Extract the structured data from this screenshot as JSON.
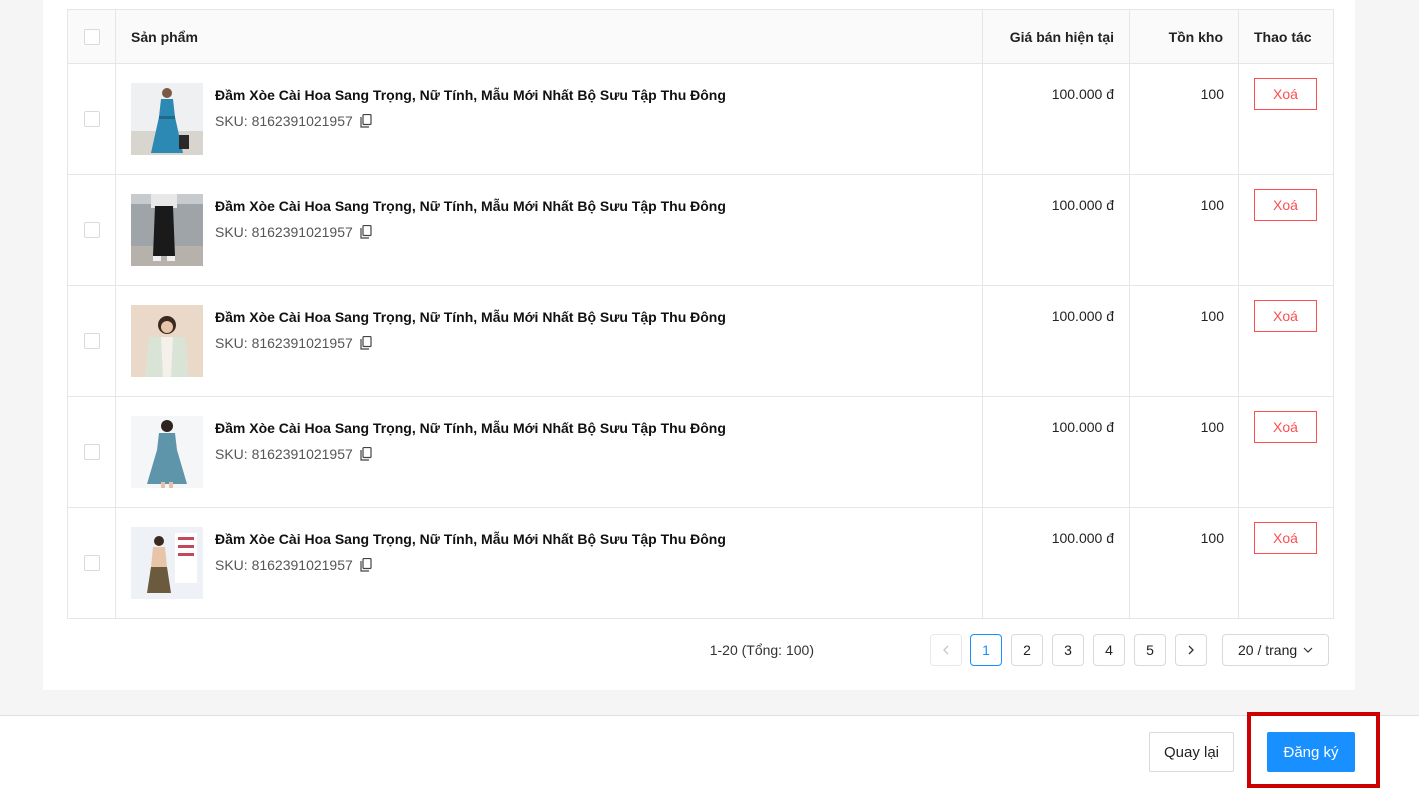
{
  "table": {
    "headers": {
      "product": "Sản phẩm",
      "price": "Giá bán hiện tại",
      "stock": "Tồn kho",
      "action": "Thao tác"
    },
    "rows": [
      {
        "name": "Đầm Xòe Cài Hoa Sang Trọng, Nữ Tính, Mẫu Mới Nhất Bộ Sưu Tập Thu Đông",
        "sku": "SKU: 8162391021957",
        "price": "100.000 đ",
        "stock": "100",
        "delete_label": "Xoá"
      },
      {
        "name": "Đầm Xòe Cài Hoa Sang Trọng, Nữ Tính, Mẫu Mới Nhất Bộ Sưu Tập Thu Đông",
        "sku": "SKU: 8162391021957",
        "price": "100.000 đ",
        "stock": "100",
        "delete_label": "Xoá"
      },
      {
        "name": "Đầm Xòe Cài Hoa Sang Trọng, Nữ Tính, Mẫu Mới Nhất Bộ Sưu Tập Thu Đông",
        "sku": "SKU: 8162391021957",
        "price": "100.000 đ",
        "stock": "100",
        "delete_label": "Xoá"
      },
      {
        "name": "Đầm Xòe Cài Hoa Sang Trọng, Nữ Tính, Mẫu Mới Nhất Bộ Sưu Tập Thu Đông",
        "sku": "SKU: 8162391021957",
        "price": "100.000 đ",
        "stock": "100",
        "delete_label": "Xoá"
      },
      {
        "name": "Đầm Xòe Cài Hoa Sang Trọng, Nữ Tính, Mẫu Mới Nhất Bộ Sưu Tập Thu Đông",
        "sku": "SKU: 8162391021957",
        "price": "100.000 đ",
        "stock": "100",
        "delete_label": "Xoá"
      }
    ]
  },
  "pagination": {
    "total_text": "1-20 (Tổng: 100)",
    "prev_icon": "chevron-left-icon",
    "pages": [
      "1",
      "2",
      "3",
      "4",
      "5"
    ],
    "current_page": "1",
    "next_icon": "chevron-right-icon",
    "page_size": "20 / trang"
  },
  "footer": {
    "back_label": "Quay lại",
    "submit_label": "Đăng ký"
  },
  "colors": {
    "primary": "#1890ff",
    "danger": "#ff4d4f",
    "highlight": "#cc0000"
  }
}
